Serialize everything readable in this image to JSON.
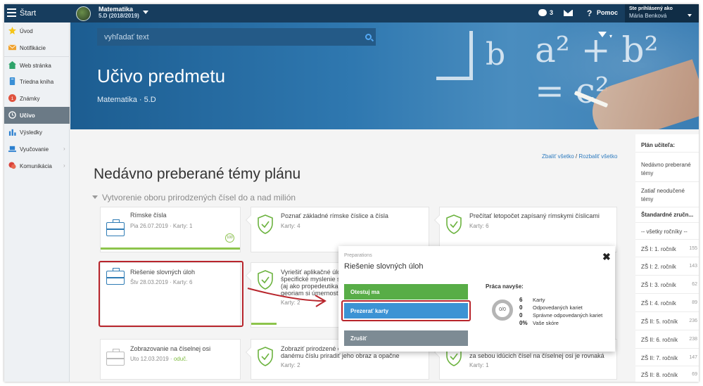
{
  "topbar": {
    "start_label": "Štart",
    "subject": "Matematika",
    "class_label": "5.D (2018/2019)",
    "messages_count": "3",
    "help_label": "Pomoc",
    "logged_in_label": "Ste prihlásený ako",
    "user_name": "Mária Benková"
  },
  "sidebar": {
    "items": [
      {
        "label": "Úvod",
        "icon": "star-icon"
      },
      {
        "label": "Notifikácie",
        "icon": "envelope-icon"
      },
      {
        "label": "Web stránka",
        "icon": "home-icon"
      },
      {
        "label": "Triedna kniha",
        "icon": "book-icon"
      },
      {
        "label": "Známky",
        "icon": "grade-icon"
      },
      {
        "label": "Učivo",
        "icon": "clock-icon"
      },
      {
        "label": "Výsledky",
        "icon": "bar-chart-icon"
      },
      {
        "label": "Vyučovanie",
        "icon": "laptop-icon"
      },
      {
        "label": "Komunikácia",
        "icon": "chat-icon"
      }
    ]
  },
  "hero": {
    "search_placeholder": "vyhľadať text",
    "title": "Učivo predmetu",
    "subtitle": "Matematika · 5.D",
    "chalk_b": "b",
    "chalk_formula": "a² + b² = c²"
  },
  "main": {
    "expand_all": "Zbaliť všetko",
    "collapse_all": "Rozbaliť všetko",
    "section_title": "Nedávno preberané témy plánu",
    "group_title": "Vytvorenie oboru prirodzených čísel do a nad milión",
    "cards": [
      {
        "title": "Rímske čísla",
        "meta": "Pia 26.07.2019 · Karty: 1",
        "badge": "100"
      },
      {
        "title": "Poznať základné rímske číslice a čísla",
        "meta": "Karty: 4"
      },
      {
        "title": "Prečítať letopočet zapísaný rímskymi číslicami",
        "meta": "Karty: 6"
      },
      {
        "title": "Riešenie slovných úloh",
        "meta": "Štv 28.03.2019 · Karty: 6"
      },
      {
        "title_l1": "Vyriešiť aplikačné úloh",
        "title_l2": "špecifické myslenie s",
        "title_l3": "(aj ako propedeutika z",
        "title_l4": "georiam si úmernosti)",
        "meta": "Karty: 2"
      },
      {
        "title": "Zobrazovanie na číselnej osi",
        "meta_prefix": "Uto 12.03.2019 · ",
        "meta_status": "oduč."
      },
      {
        "title_l1": "Zobraziť prirodzené č",
        "title_l2": "danému číslu priradiť jeho obraz a opačne",
        "meta": "Karty: 2"
      },
      {
        "title": "za sebou idúcich čísel na číselnej osi je rovnaká",
        "meta": "Karty: 1"
      }
    ]
  },
  "right_panel": {
    "plan_title": "Plán učiteľa:",
    "recent": "Nedávno preberané témy",
    "untaught": "Zatiaľ neodučené témy",
    "standards": "Štandardné zručn...",
    "all_years": "-- všetky ročníky --",
    "years": [
      {
        "label": "ZŠ I: 1. ročník",
        "count": "155"
      },
      {
        "label": "ZŠ I: 2. ročník",
        "count": "143"
      },
      {
        "label": "ZŠ I: 3. ročník",
        "count": "62"
      },
      {
        "label": "ZŠ I: 4. ročník",
        "count": "89"
      },
      {
        "label": "ZŠ II: 5. ročník",
        "count": "236"
      },
      {
        "label": "ZŠ II: 6. ročník",
        "count": "238"
      },
      {
        "label": "ZŠ II: 7. ročník",
        "count": "147"
      },
      {
        "label": "ZŠ II: 8. ročník",
        "count": "69"
      }
    ]
  },
  "modal": {
    "supertitle": "Preparations",
    "title": "Riešenie slovných úloh",
    "btn_test": "Otestuj ma",
    "btn_browse": "Prezerať karty",
    "btn_cancel": "Zrušiť",
    "stats_title": "Práca navyše:",
    "donut": "0/0",
    "stats": [
      {
        "num": "6",
        "label": "Karty"
      },
      {
        "num": "0",
        "label": "Odpovedaných kariet"
      },
      {
        "num": "0",
        "label": "Správne odpovedaných kariet"
      },
      {
        "num": "0%",
        "label": "Vaše skóre"
      }
    ]
  },
  "colors": {
    "topbar": "#173d5e",
    "hero": "#2f78b0",
    "green": "#58ad47",
    "blue": "#3c93d4",
    "highlight_red": "#b8252c"
  }
}
